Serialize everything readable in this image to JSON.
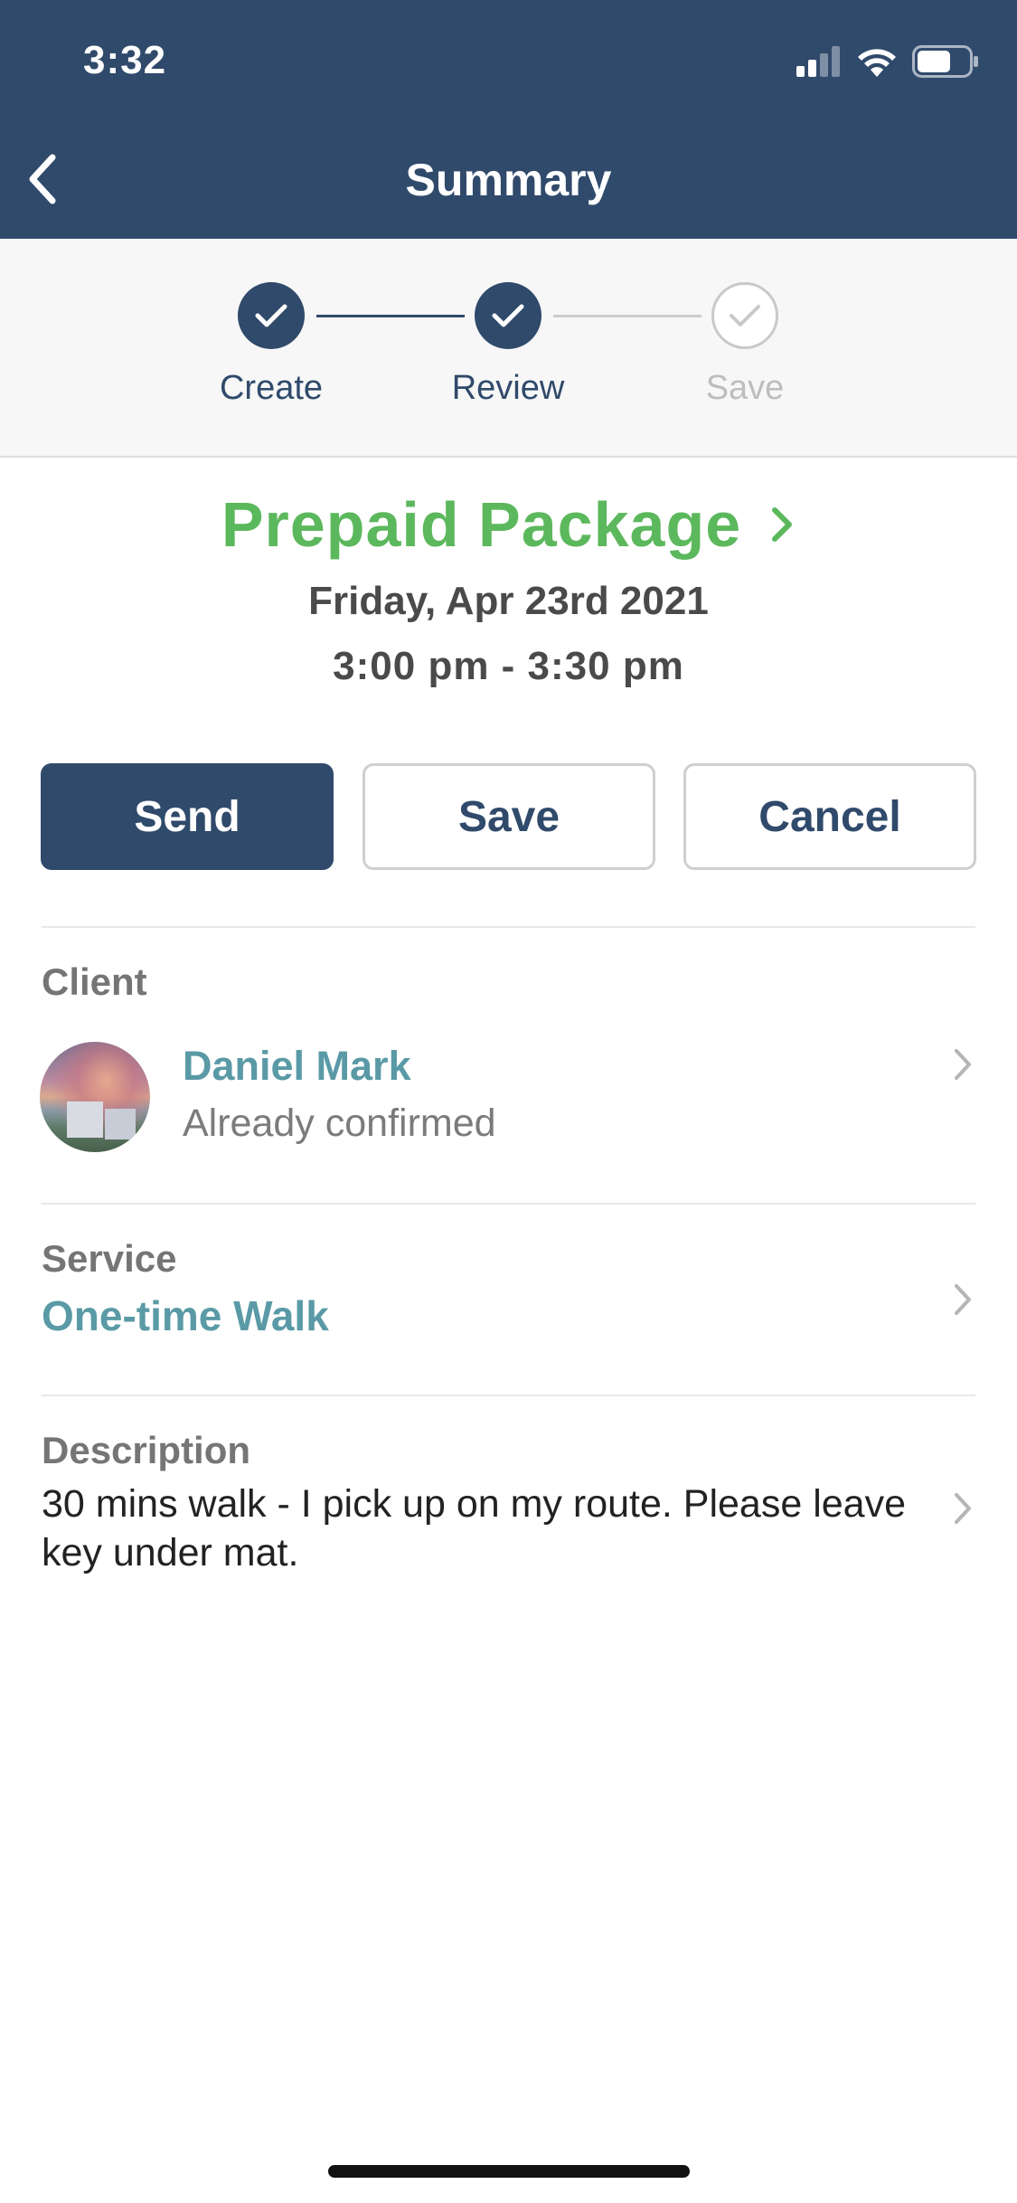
{
  "status_bar": {
    "time": "3:32"
  },
  "header": {
    "title": "Summary"
  },
  "stepper": {
    "steps": [
      {
        "label": "Create",
        "state": "done"
      },
      {
        "label": "Review",
        "state": "done"
      },
      {
        "label": "Save",
        "state": "todo"
      }
    ]
  },
  "package": {
    "title": "Prepaid Package",
    "date": "Friday, Apr 23rd 2021",
    "time": "3:00 pm - 3:30 pm"
  },
  "actions": {
    "send": "Send",
    "save": "Save",
    "cancel": "Cancel"
  },
  "client": {
    "label": "Client",
    "name": "Daniel Mark",
    "status": "Already confirmed"
  },
  "service": {
    "label": "Service",
    "value": "One-time Walk"
  },
  "description": {
    "label": "Description",
    "value": "30 mins walk - I pick up on my route. Please leave key under mat."
  },
  "colors": {
    "brand_navy": "#304a6b",
    "accent_green": "#5cb85c",
    "link_teal": "#5a9aa6"
  }
}
